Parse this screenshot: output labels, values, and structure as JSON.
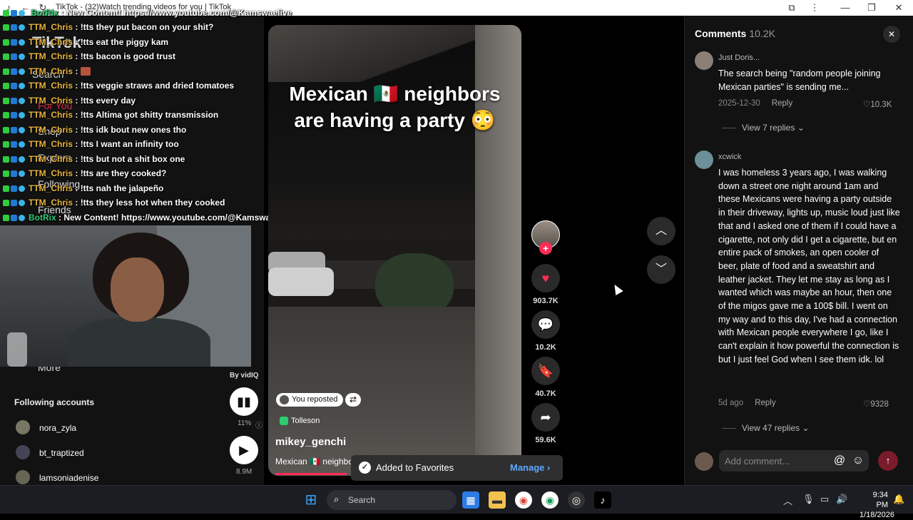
{
  "browser": {
    "title": "TikTok - (32)Watch trending videos for you | TikTok"
  },
  "sidebar_faded": {
    "logo": "TikTok",
    "search": "Search",
    "for_you": "For You",
    "shop": "Shop",
    "explore": "Explore",
    "following": "Following",
    "friends": "Friends",
    "more": "More",
    "following_accounts_title": "Following accounts",
    "accounts": [
      "nora_zyla",
      "bt_traptized",
      "lamsoniadenise"
    ]
  },
  "chat": {
    "top_line": {
      "user": "BotRix",
      "message": "New Content! https://www.youtube.com/@Kamswaelive"
    },
    "lines": [
      {
        "user": "TTM_Chris",
        "message": "!tts they put bacon on your shit?"
      },
      {
        "user": "TTM_Chris",
        "message": "!tts eat the piggy kam"
      },
      {
        "user": "TTM_Chris",
        "message": "!tts bacon is good trust"
      },
      {
        "user": "TTM_Chris",
        "message": ""
      },
      {
        "user": "TTM_Chris",
        "message": "!tts veggie straws and dried tomatoes"
      },
      {
        "user": "TTM_Chris",
        "message": "!tts every day"
      },
      {
        "user": "TTM_Chris",
        "message": "!tts Altima got shitty transmission"
      },
      {
        "user": "TTM_Chris",
        "message": "!tts idk bout new ones tho"
      },
      {
        "user": "TTM_Chris",
        "message": "!tts I want an infinity too"
      },
      {
        "user": "TTM_Chris",
        "message": "!tts but not a shit box one"
      },
      {
        "user": "TTM_Chris",
        "message": "!tts are they cooked?"
      },
      {
        "user": "TTM_Chris",
        "message": "!tts nah the jalapeño"
      },
      {
        "user": "TTM_Chris",
        "message": "!tts they less hot when they cooked"
      },
      {
        "user": "BotRix",
        "message": "New Content! https://www.youtube.com/@Kamswaelive"
      }
    ]
  },
  "vidiq": {
    "by": "By vidIQ",
    "percent": "11%",
    "views": "8.9M"
  },
  "video": {
    "caption_line1": "Mexican 🇲🇽 neighbors",
    "caption_line2": "are having a party 😳",
    "repost_label": "You reposted",
    "location": "Tolleson",
    "author": "mikey_genchi",
    "description": "Mexican 🇲🇽 neighbo"
  },
  "actions": {
    "likes": "903.7K",
    "comments": "10.2K",
    "saves": "40.7K",
    "shares": "59.6K"
  },
  "toast": {
    "message": "Added to Favorites",
    "manage": "Manage"
  },
  "comments": {
    "title": "Comments",
    "count": "10.2K",
    "items": [
      {
        "user": "Just Doris...",
        "text": "The search being \"random people joining Mexican parties\" is sending me...",
        "date": "2025-12-30",
        "reply": "Reply",
        "likes": "10.3K",
        "view_replies": "View 7 replies"
      },
      {
        "user": "xcwick",
        "text": "I was homeless 3 years ago, I was walking down a street one night around 1am and these Mexicans were having a party outside in their driveway, lights up, music loud just like that and I asked one of them if I could have a cigarette, not only did I get a cigarette, but en entire pack of smokes, an open cooler of beer, plate of food and a sweatshirt and leather jacket. They let me stay as long as I wanted which was maybe an hour, then one of the migos gave me a 100$ bill. I went on my way and to this day, I've had a connection with Mexican people everywhere I go, like I can't explain it how powerful the connection is but I just feel God when I see them idk. lol",
        "date": "5d ago",
        "reply": "Reply",
        "likes": "9328",
        "view_replies": "View 47 replies"
      }
    ],
    "add_placeholder": "Add comment..."
  },
  "taskbar": {
    "search_placeholder": "Search",
    "time": "9:34 PM",
    "date": "1/18/2026"
  }
}
